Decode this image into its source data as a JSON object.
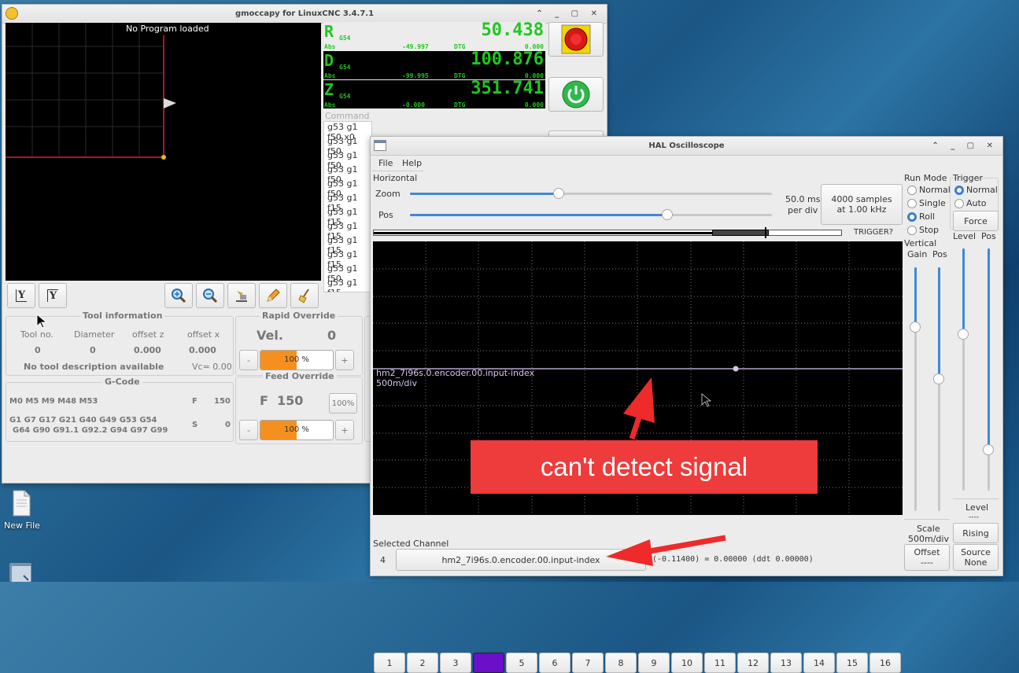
{
  "desktop": {
    "new_file_label": "New File"
  },
  "gmoccapy": {
    "title": "gmoccapy for LinuxCNC  3.4.7.1",
    "preview_text": "No Program loaded",
    "view_btn_1": "Y",
    "view_btn_2": "Y",
    "dro": [
      {
        "letter": "R",
        "coord": "G54",
        "value": "50.438",
        "abs_label": "Abs",
        "abs_value": "-49.997",
        "dtg_label": "DTG",
        "dtg_value": "0.000"
      },
      {
        "letter": "D",
        "coord": "G54",
        "value": "100.876",
        "abs_label": "Abs",
        "abs_value": "-99.995",
        "dtg_label": "DTG",
        "dtg_value": "0.000"
      },
      {
        "letter": "Z",
        "coord": "G54",
        "value": "351.741",
        "abs_label": "Abs",
        "abs_value": "-0.000",
        "dtg_label": "DTG",
        "dtg_value": "0.000"
      }
    ],
    "command_label": "Command",
    "commands": [
      "g53 g1 f50 x0",
      "g53 g1 f50",
      "g53 g1 f50",
      "g53 g1 f50",
      "g53 g1 f50",
      "g53 g1 f15",
      "g53 g1 f15",
      "g53 g1 f15",
      "g53 g1 f15",
      "g53 g1 f15",
      "g53 g1 f50",
      "g53 g1 f15"
    ],
    "tool": {
      "title": "Tool information",
      "h_no": "Tool no.",
      "h_dia": "Diameter",
      "h_offz": "offset z",
      "h_offx": "offset x",
      "v_no": "0",
      "v_dia": "0",
      "v_offz": "0.000",
      "v_offx": "0.000",
      "desc": "No tool description available",
      "vc": "Vc= 0.00"
    },
    "rapid": {
      "title": "Rapid Override",
      "vel_label": "Vel.",
      "vel_value": "0",
      "minus": "-",
      "plus": "+",
      "pct": "100 %",
      "pct_value": 100
    },
    "feed": {
      "title": "Feed Override",
      "f_label": "F",
      "f_value": "150",
      "minus": "-",
      "plus": "+",
      "pct": "100 %",
      "pct_value": 100,
      "side": "100%"
    },
    "gcode": {
      "title": "G-Code",
      "mcodes": "M0 M5 M9 M48 M53",
      "f_label": "F",
      "f_value": "150",
      "gcodes_1": "G1 G7 G17 G21 G40 G49 G53 G54",
      "gcodes_2": "G64 G90 G91.1 G92.2 G94 G97 G99",
      "s_label": "S",
      "s_value": "0"
    }
  },
  "scope": {
    "title": "HAL Oscilloscope",
    "menu": [
      "File",
      "Help"
    ],
    "horizontal_label": "Horizontal",
    "zoom_label": "Zoom",
    "zoom_value": 0.41,
    "pos_label": "Pos",
    "pos_value": 0.71,
    "rate_1": "50.0 ms",
    "rate_2": "per div",
    "samples_1": "4000 samples",
    "samples_2": "at 1.00 kHz",
    "trigger_q": "TRIGGER?",
    "trace_name": "hm2_7i96s.0.encoder.00.input-index",
    "trace_scale": "500m/div",
    "annotation": "can't detect signal",
    "channels": [
      "1",
      "2",
      "3",
      "4",
      "5",
      "6",
      "7",
      "8",
      "9",
      "10",
      "11",
      "12",
      "13",
      "14",
      "15",
      "16"
    ],
    "selected_channel_index": 3,
    "selected_label": "Selected Channel",
    "selected_num": "4",
    "selected_name": "hm2_7i96s.0.encoder.00.input-index",
    "readout": "f(-0.11400) =  0.00000 (ddt  0.00000)",
    "run_mode": {
      "title": "Run Mode",
      "options": [
        "Normal",
        "Single",
        "Roll",
        "Stop"
      ],
      "selected": "Roll"
    },
    "trigger": {
      "title": "Trigger",
      "options": [
        "Normal",
        "Auto"
      ],
      "selected": "Normal",
      "force": "Force",
      "level_label": "Level",
      "pos_label": "Pos",
      "level_value_label": "Level",
      "level_value": "----",
      "rising": "Rising",
      "source_label": "Source",
      "source_value": "None"
    },
    "vertical": {
      "title": "Vertical",
      "gain_label": "Gain",
      "pos_label": "Pos",
      "scale_label": "Scale",
      "scale_value": "500m/div",
      "offset_label": "Offset",
      "offset_value": "----"
    }
  }
}
